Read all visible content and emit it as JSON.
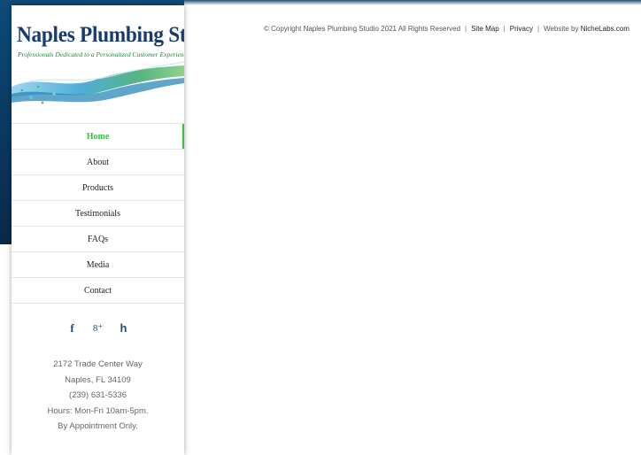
{
  "brand": {
    "title": "Naples Plumbing Studio",
    "tagline": "Professionals Dedicated to a Personalized Customer Experience",
    "title_color": "#173b6e",
    "tagline_color": "#1b8a3a"
  },
  "nav": {
    "active_color": "#3cbf3c",
    "items": [
      {
        "label": "Home",
        "active": true
      },
      {
        "label": "About",
        "active": false
      },
      {
        "label": "Products",
        "active": false
      },
      {
        "label": "Testimonials",
        "active": false
      },
      {
        "label": "FAQs",
        "active": false
      },
      {
        "label": "Media",
        "active": false
      },
      {
        "label": "Contact",
        "active": false
      }
    ]
  },
  "social": {
    "icons": [
      "facebook-icon",
      "google-plus-icon",
      "houzz-icon"
    ],
    "glyphs": {
      "facebook": "f",
      "google_plus": "8⁺",
      "houzz": "h"
    }
  },
  "address": {
    "street": "2172 Trade Center Way",
    "city": "Naples, FL 34109",
    "phone": "(239) 631-5336",
    "hours": "Hours: Mon-Fri 10am-5pm.",
    "note": "By Appointment Only."
  },
  "footer": {
    "copyright": "© Copyright Naples Plumbing Studio 2021 All Rights Reserved",
    "sep": "|",
    "site_map": "Site Map",
    "privacy": "Privacy",
    "website_by_prefix": "Website by ",
    "website_by_link": "NicheLabs.com"
  }
}
